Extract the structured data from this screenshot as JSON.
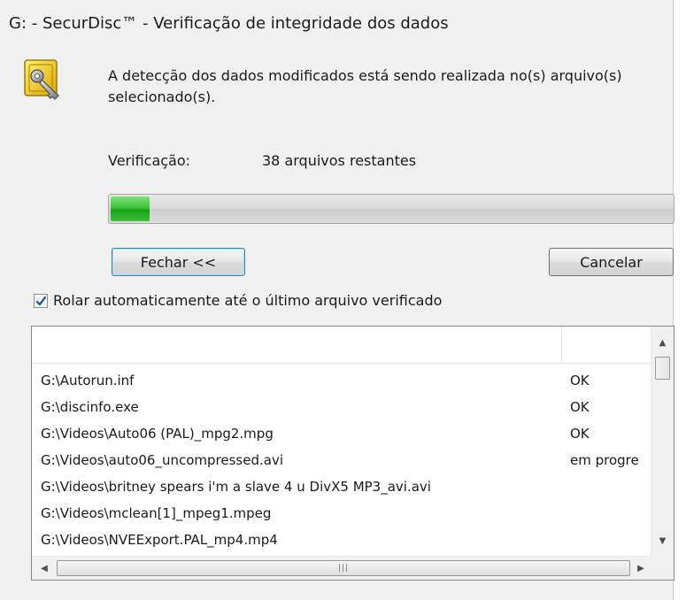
{
  "window": {
    "title": "G: - SecurDisc™ - Verificação de integridade dos dados"
  },
  "message": "A detecção dos dados modificados está sendo realizada no(s) arquivo(s) selecionado(s).",
  "verification": {
    "label": "Verificação:",
    "remaining": "38 arquivos restantes",
    "progress_fraction": 0.07
  },
  "buttons": {
    "close_label": "Fechar <<",
    "cancel_label": "Cancelar"
  },
  "autoscroll": {
    "label": "Rolar automaticamente até o último arquivo verificado",
    "checked": true
  },
  "list": {
    "rows": [
      {
        "file": "G:\\Autorun.inf",
        "status": "OK"
      },
      {
        "file": "G:\\discinfo.exe",
        "status": "OK"
      },
      {
        "file": "G:\\Videos\\Auto06 (PAL)_mpg2.mpg",
        "status": "OK"
      },
      {
        "file": "G:\\Videos\\auto06_uncompressed.avi",
        "status": "em progre"
      },
      {
        "file": "G:\\Videos\\britney spears i'm a slave 4 u DivX5 MP3_avi.avi",
        "status": ""
      },
      {
        "file": "G:\\Videos\\mclean[1]_mpeg1.mpeg",
        "status": ""
      },
      {
        "file": "G:\\Videos\\NVEExport.PAL_mp4.mp4",
        "status": ""
      }
    ]
  },
  "icons": {
    "dialog": "safe-key-icon",
    "scroll_up": "scroll-up-arrow-icon",
    "scroll_down": "scroll-down-arrow-icon",
    "scroll_left": "scroll-left-arrow-icon",
    "scroll_right": "scroll-right-arrow-icon",
    "checkmark": "checkmark-icon"
  },
  "colors": {
    "progress_fill": "#17a417",
    "default_button_border": "#3c7fb1"
  }
}
